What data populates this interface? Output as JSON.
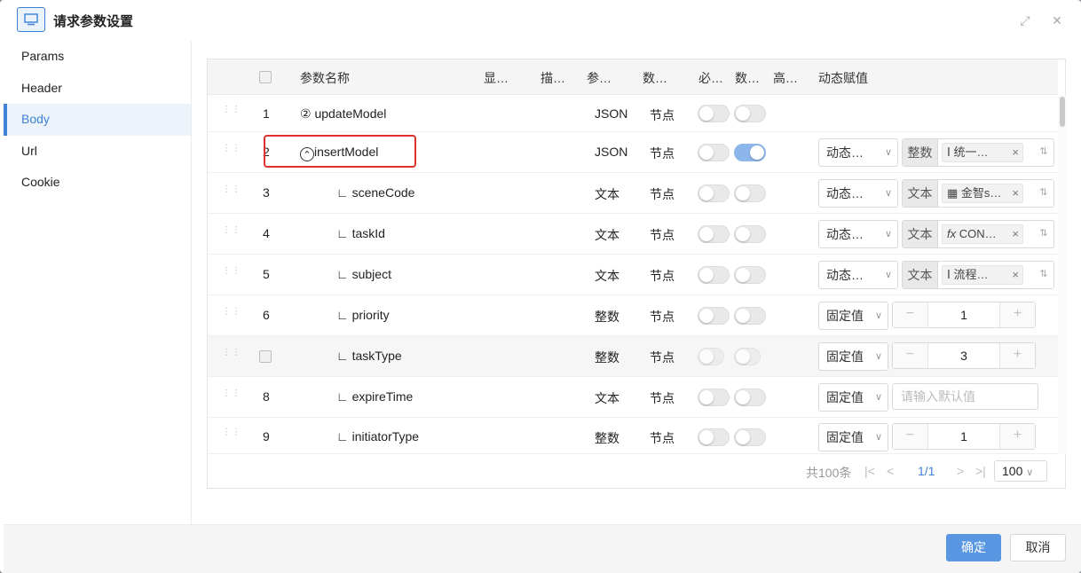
{
  "dialog": {
    "title": "请求参数设置",
    "expand_glyph": "⤢",
    "close_glyph": "✕"
  },
  "sidebar": {
    "items": [
      {
        "label": "Params",
        "active": false
      },
      {
        "label": "Header",
        "active": false
      },
      {
        "label": "Body",
        "active": true
      },
      {
        "label": "Url",
        "active": false
      },
      {
        "label": "Cookie",
        "active": false
      }
    ]
  },
  "table": {
    "columns": {
      "name": "参数名称",
      "display": "显…",
      "desc": "描…",
      "param_type": "参…",
      "data_type": "数…",
      "required": "必…",
      "data": "数…",
      "advanced": "高…",
      "dynamic": "动态赋值"
    },
    "rows": [
      {
        "index": "1",
        "prefix": "②",
        "name": "updateModel",
        "type": "JSON",
        "kind": "节点",
        "required_on": false,
        "data_on": false
      },
      {
        "index": "2",
        "prefix": "⌃",
        "name": "insertModel",
        "type": "JSON",
        "kind": "节点",
        "required_on": false,
        "data_on": true,
        "assign_mode": "动态…",
        "value_type": "整数",
        "tag_icon": "Ⅰ",
        "tag_label": "统一…",
        "tag_close": "×",
        "sym": "⇅"
      },
      {
        "index": "3",
        "prefix": "∟",
        "name": "sceneCode",
        "type": "文本",
        "kind": "节点",
        "required_on": false,
        "data_on": false,
        "assign_mode": "动态…",
        "value_type": "文本",
        "tag_icon": "▦",
        "tag_label": "金智s…",
        "tag_close": "×",
        "sym": "⇅"
      },
      {
        "index": "4",
        "prefix": "∟",
        "name": "taskId",
        "type": "文本",
        "kind": "节点",
        "required_on": false,
        "data_on": false,
        "assign_mode": "动态…",
        "value_type": "文本",
        "tag_icon": "fx",
        "tag_label": "CON…",
        "tag_close": "×",
        "sym": "⇅"
      },
      {
        "index": "5",
        "prefix": "∟",
        "name": "subject",
        "type": "文本",
        "kind": "节点",
        "required_on": false,
        "data_on": false,
        "assign_mode": "动态…",
        "value_type": "文本",
        "tag_icon": "Ⅰ",
        "tag_label": "流程…",
        "tag_close": "×",
        "sym": "⇅"
      },
      {
        "index": "6",
        "prefix": "∟",
        "name": "priority",
        "type": "整数",
        "kind": "节点",
        "required_on": false,
        "data_on": false,
        "assign_mode": "固定值",
        "stepper_value": "1",
        "minus": "−",
        "plus": "+"
      },
      {
        "index": "",
        "prefix": "∟",
        "name": "taskType",
        "type": "整数",
        "kind": "节点",
        "required_on": false,
        "data_on": false,
        "assign_mode": "固定值",
        "stepper_value": "3",
        "minus": "−",
        "plus": "+"
      },
      {
        "index": "8",
        "prefix": "∟",
        "name": "expireTime",
        "type": "文本",
        "kind": "节点",
        "required_on": false,
        "data_on": false,
        "assign_mode": "固定值",
        "placeholder": "请输入默认值"
      },
      {
        "index": "9",
        "prefix": "∟",
        "name": "initiatorType",
        "type": "整数",
        "kind": "节点",
        "required_on": false,
        "data_on": false,
        "assign_mode": "固定值",
        "stepper_value": "1",
        "minus": "−",
        "plus": "+"
      }
    ]
  },
  "pagination": {
    "total": "共100条",
    "first": "|<",
    "prev": "<",
    "current": "1/1",
    "next": ">",
    "last": ">|",
    "page_size": "100",
    "size_arrow": "∨"
  },
  "footer": {
    "confirm": "确定",
    "cancel": "取消"
  },
  "colors": {
    "accent": "#3f82d6",
    "primary_button": "#5a97e3",
    "highlight": "#e0322c"
  }
}
